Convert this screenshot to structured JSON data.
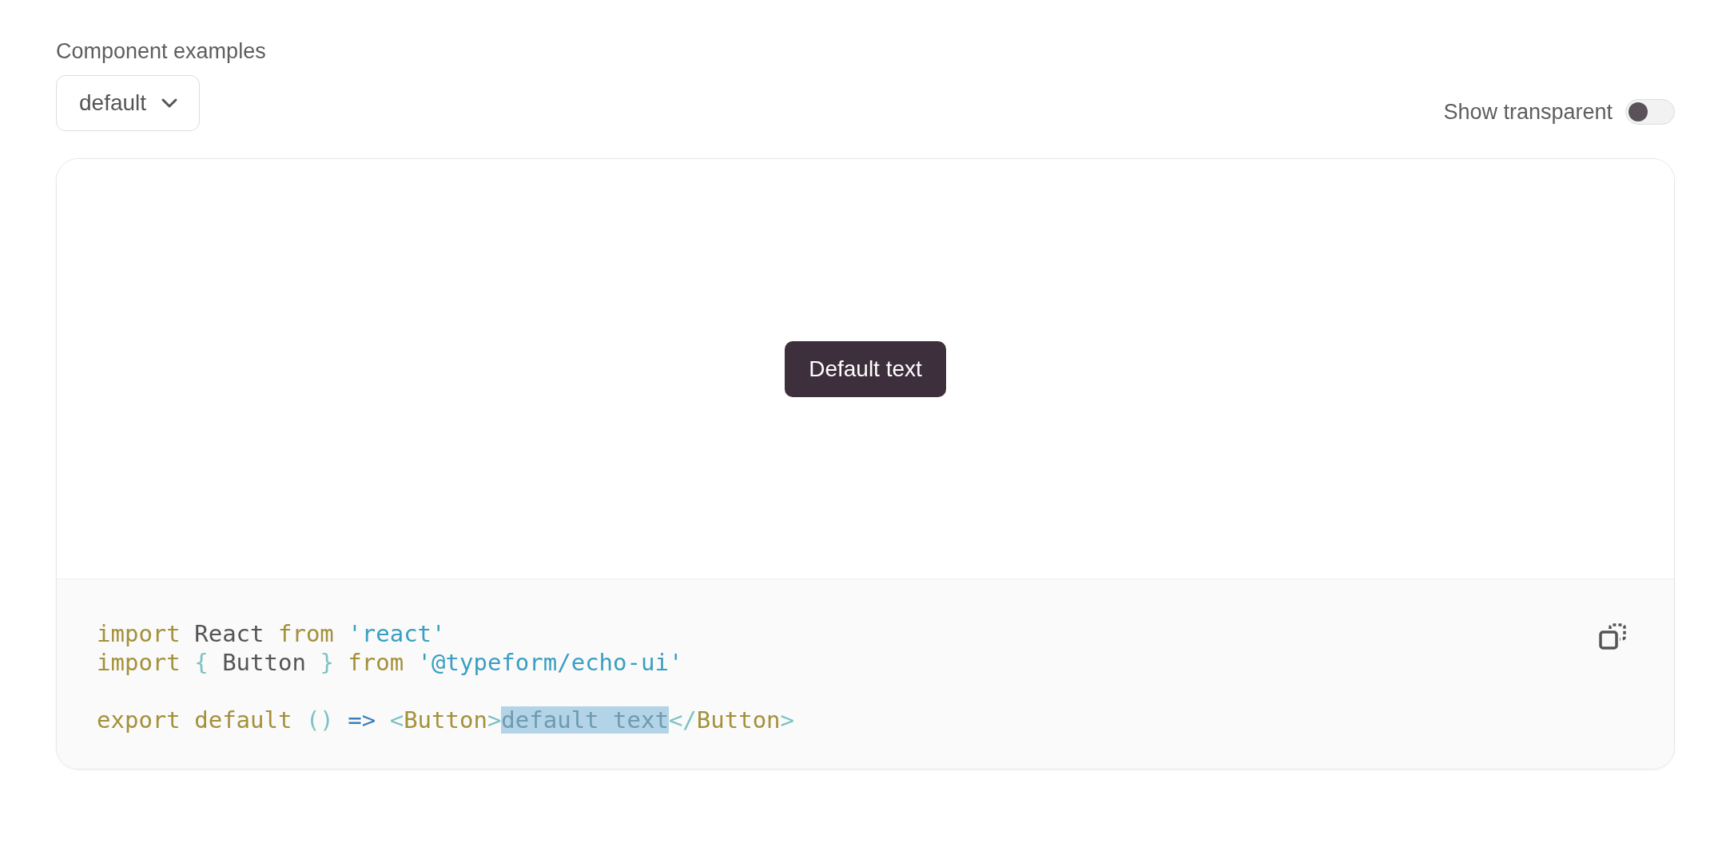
{
  "heading": "Component examples",
  "variant_select": {
    "value": "default"
  },
  "transparent_toggle": {
    "label": "Show transparent",
    "on": false
  },
  "preview": {
    "button": {
      "label": "Default text"
    }
  },
  "code": {
    "lines": [
      {
        "kind": "code",
        "tokens": [
          {
            "kind": "keyword",
            "text": "import",
            "selected": false
          },
          {
            "kind": "ident",
            "text": " React ",
            "selected": false
          },
          {
            "kind": "keyword",
            "text": "from",
            "selected": false
          },
          {
            "kind": "string",
            "text": " 'react'",
            "selected": false
          }
        ]
      },
      {
        "kind": "code",
        "tokens": [
          {
            "kind": "keyword",
            "text": "import",
            "selected": false
          },
          {
            "kind": "punct",
            "text": " { ",
            "selected": false
          },
          {
            "kind": "ident",
            "text": "Button",
            "selected": false
          },
          {
            "kind": "punct",
            "text": " } ",
            "selected": false
          },
          {
            "kind": "keyword",
            "text": "from",
            "selected": false
          },
          {
            "kind": "string",
            "text": " '@typeform/echo-ui'",
            "selected": false
          }
        ]
      },
      {
        "kind": "blank"
      },
      {
        "kind": "code",
        "tokens": [
          {
            "kind": "keyword",
            "text": "export default",
            "selected": false
          },
          {
            "kind": "punct",
            "text": " () ",
            "selected": false
          },
          {
            "kind": "operator",
            "text": "=>",
            "selected": false
          },
          {
            "kind": "punct",
            "text": " <",
            "selected": false
          },
          {
            "kind": "keyword",
            "text": "Button",
            "selected": false
          },
          {
            "kind": "punct",
            "text": ">",
            "selected": false
          },
          {
            "kind": "text",
            "text": "default text",
            "selected": true
          },
          {
            "kind": "punct",
            "text": "</",
            "selected": false
          },
          {
            "kind": "keyword",
            "text": "Button",
            "selected": false
          },
          {
            "kind": "punct",
            "text": ">",
            "selected": false
          }
        ]
      }
    ]
  }
}
